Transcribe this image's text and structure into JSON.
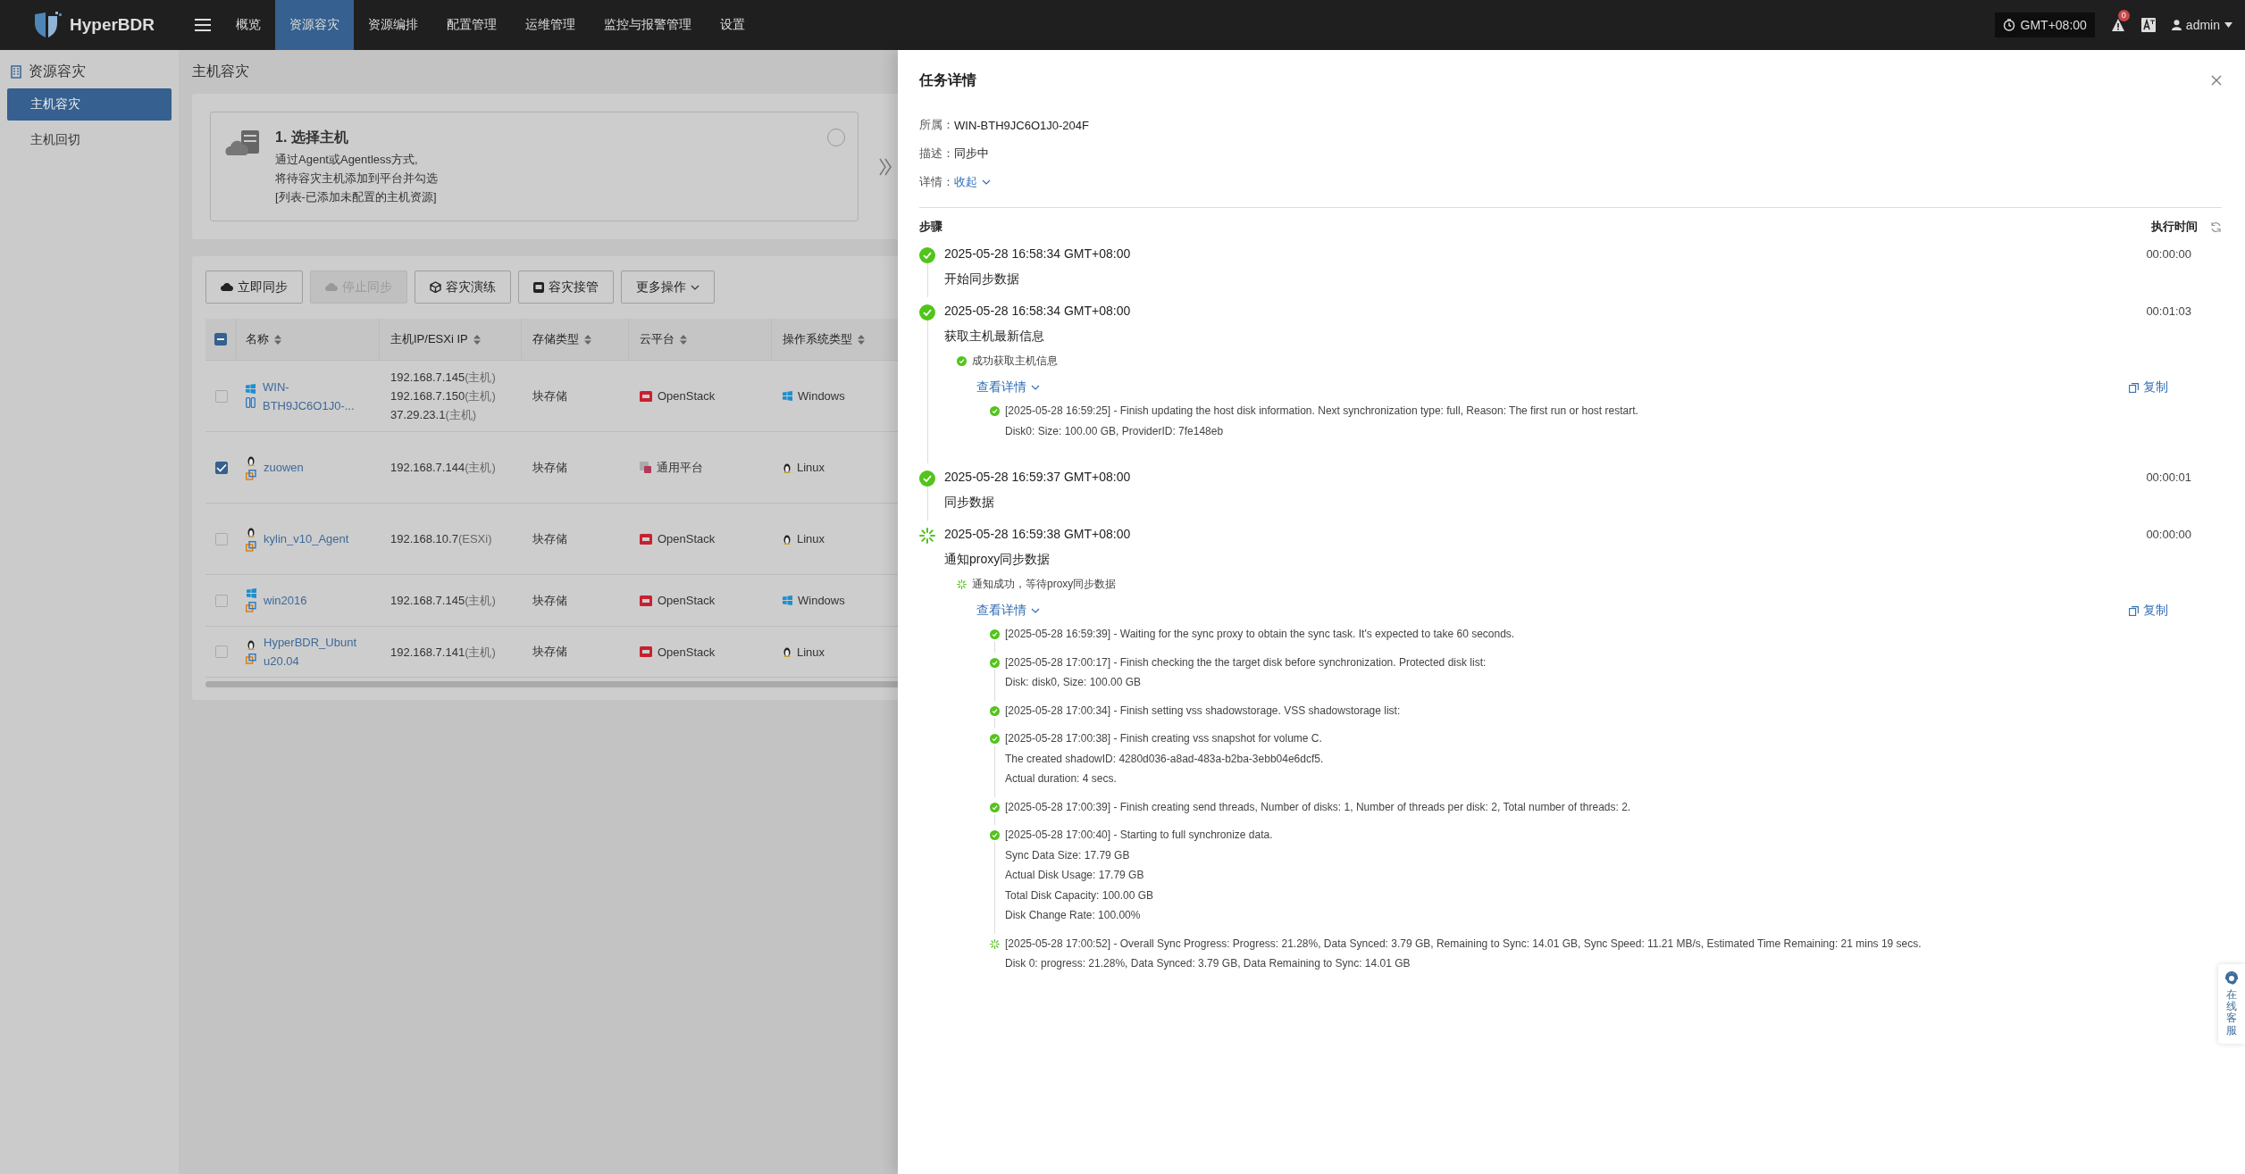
{
  "topbar": {
    "brand": "HyperBDR",
    "nav": [
      {
        "label": "概览",
        "selected": false
      },
      {
        "label": "资源容灾",
        "selected": true
      },
      {
        "label": "资源编排",
        "selected": false
      },
      {
        "label": "配置管理",
        "selected": false
      },
      {
        "label": "运维管理",
        "selected": false
      },
      {
        "label": "监控与报警管理",
        "selected": false
      },
      {
        "label": "设置",
        "selected": false
      }
    ],
    "timezone": "GMT+08:00",
    "alert_count": "0",
    "user": "admin"
  },
  "sidebar": {
    "section": "资源容灾",
    "items": [
      {
        "label": "主机容灾",
        "selected": true
      },
      {
        "label": "主机回切",
        "selected": false
      }
    ]
  },
  "page_title": "主机容灾",
  "wizard_step": {
    "title": "1. 选择主机",
    "lines": [
      "通过Agent或Agentless方式,",
      "将待容灾主机添加到平台并勾选",
      "[列表-已添加未配置的主机资源]"
    ],
    "checked": false
  },
  "toolbar": [
    {
      "label": "立即同步",
      "kind": "button",
      "disabled": false
    },
    {
      "label": "停止同步",
      "kind": "button",
      "disabled": true
    },
    {
      "label": "容灾演练",
      "kind": "button",
      "disabled": false
    },
    {
      "label": "容灾接管",
      "kind": "button",
      "disabled": false
    },
    {
      "label": "更多操作",
      "kind": "dropdown",
      "disabled": false
    }
  ],
  "table": {
    "header_checkbox": {
      "indeterminate": true
    },
    "columns": [
      "名称",
      "主机IP/ESXi IP",
      "存储类型",
      "云平台",
      "操作系统类型"
    ],
    "rows": [
      {
        "selected": false,
        "name": "WIN-BTH9JC6O1J0-...",
        "host": {
          "kind": "physical"
        },
        "ips": [
          {
            "ip": "192.168.7.145",
            "tag": "(主机)"
          },
          {
            "ip": "192.168.7.150",
            "tag": "(主机)"
          },
          {
            "ip": "37.29.23.1",
            "tag": "(主机)"
          }
        ],
        "storage": "块存储",
        "cloud": {
          "kind": "openstack",
          "label": "OpenStack"
        },
        "os": {
          "kind": "windows",
          "label": "Windows"
        }
      },
      {
        "selected": true,
        "name": "zuowen",
        "host": {
          "kind": "vm"
        },
        "ips": [
          {
            "ip": "192.168.7.144",
            "tag": "(主机)"
          }
        ],
        "storage": "块存储",
        "cloud": {
          "kind": "generic",
          "label": "通用平台"
        },
        "os": {
          "kind": "linux",
          "label": "Linux"
        }
      },
      {
        "selected": false,
        "name": "kylin_v10_Agent",
        "host": {
          "kind": "vm"
        },
        "ips": [
          {
            "ip": "192.168.10.7",
            "tag": "(ESXi)"
          }
        ],
        "storage": "块存储",
        "cloud": {
          "kind": "openstack",
          "label": "OpenStack"
        },
        "os": {
          "kind": "linux",
          "label": "Linux"
        }
      },
      {
        "selected": false,
        "name": "win2016",
        "host": {
          "kind": "vm"
        },
        "ips": [
          {
            "ip": "192.168.7.145",
            "tag": "(主机)"
          }
        ],
        "storage": "块存储",
        "cloud": {
          "kind": "openstack",
          "label": "OpenStack"
        },
        "os": {
          "kind": "windows",
          "label": "Windows"
        }
      },
      {
        "selected": false,
        "name": "HyperBDR_Ubuntu20.04",
        "host": {
          "kind": "vm"
        },
        "ips": [
          {
            "ip": "192.168.7.141",
            "tag": "(主机)"
          }
        ],
        "storage": "块存储",
        "cloud": {
          "kind": "openstack",
          "label": "OpenStack"
        },
        "os": {
          "kind": "linux",
          "label": "Linux"
        }
      }
    ]
  },
  "drawer": {
    "title": "任务详情",
    "fields": [
      {
        "label": "所属：",
        "value": "WIN-BTH9JC6O1J0-204F",
        "kind": "text"
      },
      {
        "label": "描述：",
        "value": "同步中",
        "kind": "text"
      },
      {
        "label": "详情：",
        "value": "收起",
        "kind": "link"
      }
    ],
    "steps_header": "步骤",
    "time_header": "执行时间",
    "steps": [
      {
        "kind": "success",
        "timestamp": "2025-05-28 16:58:34 GMT+08:00",
        "duration": "00:00:00",
        "title": "开始同步数据"
      },
      {
        "kind": "success",
        "timestamp": "2025-05-28 16:58:34 GMT+08:00",
        "duration": "00:01:03",
        "title": "获取主机最新信息",
        "substep": {
          "kind": "success",
          "text": "成功获取主机信息"
        },
        "details": {
          "toggle": "查看详情",
          "copy": "复制",
          "logs": [
            {
              "kind": "success",
              "lines": [
                "[2025-05-28 16:59:25] - Finish updating the host disk information. Next synchronization type: full, Reason: The first run or host restart.",
                "Disk0: Size: 100.00 GB, ProviderID: 7fe148eb"
              ]
            }
          ]
        }
      },
      {
        "kind": "success",
        "timestamp": "2025-05-28 16:59:37 GMT+08:00",
        "duration": "00:00:01",
        "title": "同步数据"
      },
      {
        "kind": "running",
        "timestamp": "2025-05-28 16:59:38 GMT+08:00",
        "duration": "00:00:00",
        "title": "通知proxy同步数据",
        "substep": {
          "kind": "running",
          "text": "通知成功，等待proxy同步数据"
        },
        "details": {
          "toggle": "查看详情",
          "copy": "复制",
          "logs": [
            {
              "kind": "success",
              "lines": [
                "[2025-05-28 16:59:39] - Waiting for the sync proxy to obtain the sync task. It's expected to take 60 seconds."
              ]
            },
            {
              "kind": "success",
              "lines": [
                "[2025-05-28 17:00:17] - Finish checking the the target disk before synchronization. Protected disk list:",
                "Disk: disk0, Size: 100.00 GB"
              ]
            },
            {
              "kind": "success",
              "lines": [
                "[2025-05-28 17:00:34] - Finish setting vss shadowstorage. VSS shadowstorage list:"
              ]
            },
            {
              "kind": "success",
              "lines": [
                "[2025-05-28 17:00:38] - Finish creating vss snapshot for volume C.",
                "The created shadowID: 4280d036-a8ad-483a-b2ba-3ebb04e6dcf5.",
                "Actual duration: 4 secs."
              ]
            },
            {
              "kind": "success",
              "lines": [
                "[2025-05-28 17:00:39] - Finish creating send threads, Number of disks: 1, Number of threads per disk: 2, Total number of threads: 2."
              ]
            },
            {
              "kind": "success",
              "lines": [
                "[2025-05-28 17:00:40] - Starting to full synchronize data.",
                "Sync Data Size: 17.79 GB",
                "Actual Disk Usage: 17.79 GB",
                "Total Disk Capacity: 100.00 GB",
                "Disk Change Rate: 100.00%"
              ]
            },
            {
              "kind": "running",
              "lines": [
                "[2025-05-28 17:00:52] - Overall Sync Progress: Progress: 21.28%, Data Synced: 3.79 GB, Remaining to Sync: 14.01 GB, Sync Speed: 11.21 MB/s, Estimated Time Remaining: 21 mins 19 secs.",
                "Disk 0: progress: 21.28%, Data Synced: 3.79 GB, Data Remaining to Sync: 14.01 GB"
              ]
            }
          ]
        }
      }
    ]
  },
  "support_label": "在线客服"
}
